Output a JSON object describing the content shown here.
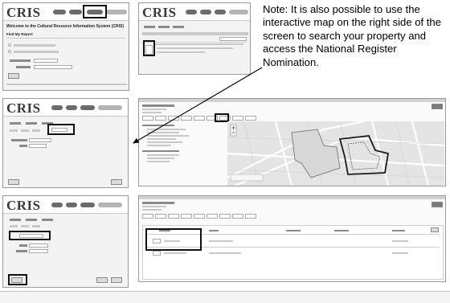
{
  "note": "Note: It is also possible to use the interactive map on the right side of the screen to search your property and access the National Register Nomination.",
  "logo": "CRIS",
  "panel1": {
    "title": "Welcome to the Cultural Resource Information System (CRIS)",
    "section": "Find My Report"
  },
  "colors": {
    "highlight": "#111111",
    "frame": "#9a9a9a",
    "arrow": "#000000"
  },
  "icons": [
    "arrow-icon",
    "map-zoom-icon",
    "map-parcel-outline-icon"
  ]
}
